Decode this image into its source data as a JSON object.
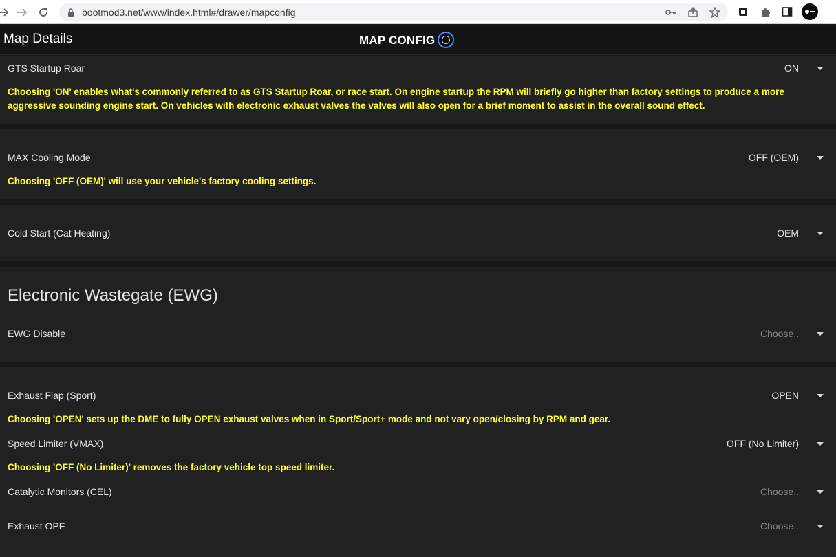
{
  "browser": {
    "url": "bootmod3.net/www/index.html#/drawer/mapconfig"
  },
  "header": {
    "left_title": "Map Details",
    "center_title": "MAP CONFIG"
  },
  "settings": [
    {
      "label": "GTS Startup Roar",
      "value": "ON",
      "description": "Choosing 'ON' enables what's commonly referred to as GTS Startup Roar, or race start. On engine startup the RPM will briefly go higher than factory settings to produce a more aggressive sounding engine start. On vehicles with electronic exhaust valves the valves will also open for a brief moment to assist in the overall sound effect."
    },
    {
      "label": "MAX Cooling Mode",
      "value": "OFF (OEM)",
      "description": "Choosing 'OFF (OEM)' will use your vehicle's factory cooling settings."
    },
    {
      "label": "Cold Start (Cat Heating)",
      "value": "OEM"
    },
    {
      "section_title": "Electronic Wastegate (EWG)"
    },
    {
      "label": "EWG Disable",
      "value": "Choose.."
    },
    {
      "label": "Exhaust Flap (Sport)",
      "value": "OPEN",
      "description": "Choosing 'OPEN' sets up the DME to fully OPEN exhaust valves when in Sport/Sport+ mode and not vary open/closing by RPM and gear."
    },
    {
      "label": "Speed Limiter (VMAX)",
      "value": "OFF (No Limiter)",
      "description": "Choosing 'OFF (No Limiter)' removes the factory vehicle top speed limiter."
    },
    {
      "label": "Catalytic Monitors (CEL)",
      "value": "Choose.."
    },
    {
      "label": "Exhaust OPF",
      "value": "Choose.."
    }
  ],
  "colors": {
    "description_text": "#ffff2a",
    "card_background": "#212121",
    "page_background": "#181818"
  }
}
